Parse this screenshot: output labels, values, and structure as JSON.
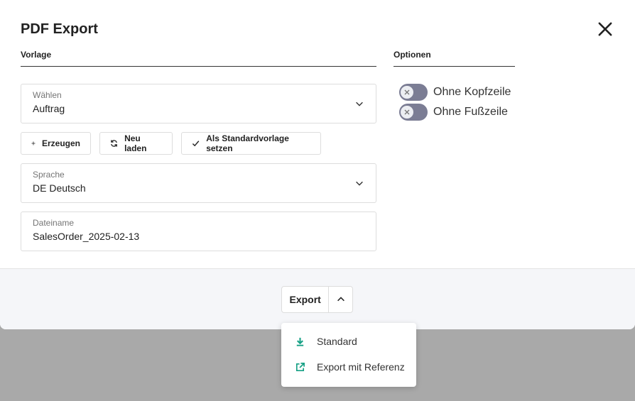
{
  "dialog": {
    "title": "PDF Export",
    "close_icon": "close-icon"
  },
  "sections": {
    "template": "Vorlage",
    "options": "Optionen"
  },
  "template_field": {
    "label": "Wählen",
    "value": "Auftrag",
    "icon": "chevron-down-icon"
  },
  "actions": {
    "create": {
      "label": "Erzeugen",
      "icon": "plus-icon"
    },
    "reload": {
      "label": "Neu laden",
      "icon": "refresh-icon"
    },
    "set_default": {
      "label": "Als Standardvorlage setzen",
      "icon": "check-icon"
    }
  },
  "language_field": {
    "label": "Sprache",
    "value": "DE Deutsch",
    "icon": "chevron-down-icon"
  },
  "filename_field": {
    "label": "Dateiname",
    "value": "SalesOrder_2025-02-13"
  },
  "options": {
    "no_header": {
      "label": "Ohne Kopfzeile",
      "on": false
    },
    "no_footer": {
      "label": "Ohne Fußzeile",
      "on": false
    }
  },
  "export": {
    "label": "Export",
    "caret_icon": "chevron-up-icon",
    "menu": [
      {
        "label": "Standard",
        "icon": "download-icon"
      },
      {
        "label": "Export mit Referenz",
        "icon": "external-link-icon"
      }
    ]
  },
  "colors": {
    "accent": "#16a085",
    "toggle_off": "#7b7d94",
    "overlay": "#a9a9a9"
  }
}
